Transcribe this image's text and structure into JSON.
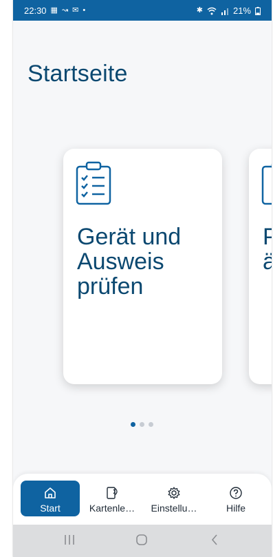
{
  "status_bar": {
    "time": "22:30",
    "left_icons": [
      "sim-icon",
      "call-forward-icon",
      "mail-icon",
      "dot-icon"
    ],
    "battery": "21%",
    "right_icons": [
      "bluetooth-icon",
      "wifi-icon",
      "signal-icon",
      "battery-icon"
    ]
  },
  "page": {
    "title": "Startseite"
  },
  "carousel": {
    "cards": [
      {
        "title": "Gerät und\nAusweis\nprüfen",
        "icon": "checklist-icon"
      },
      {
        "title": "P\nä",
        "icon": "checklist-icon"
      }
    ],
    "page_count": 3,
    "active_index": 0
  },
  "bottom_nav": {
    "items": [
      {
        "label": "Start",
        "icon": "home-icon",
        "active": true
      },
      {
        "label": "Kartenle…",
        "icon": "card-reader-icon",
        "active": false
      },
      {
        "label": "Einstellu…",
        "icon": "settings-icon",
        "active": false
      },
      {
        "label": "Hilfe",
        "icon": "help-icon",
        "active": false
      }
    ]
  },
  "system_nav": {
    "buttons": [
      "recents-button",
      "home-button",
      "back-button"
    ]
  },
  "colors": {
    "accent": "#0f63a1",
    "title": "#0b4870",
    "background": "#f6f7f9"
  }
}
